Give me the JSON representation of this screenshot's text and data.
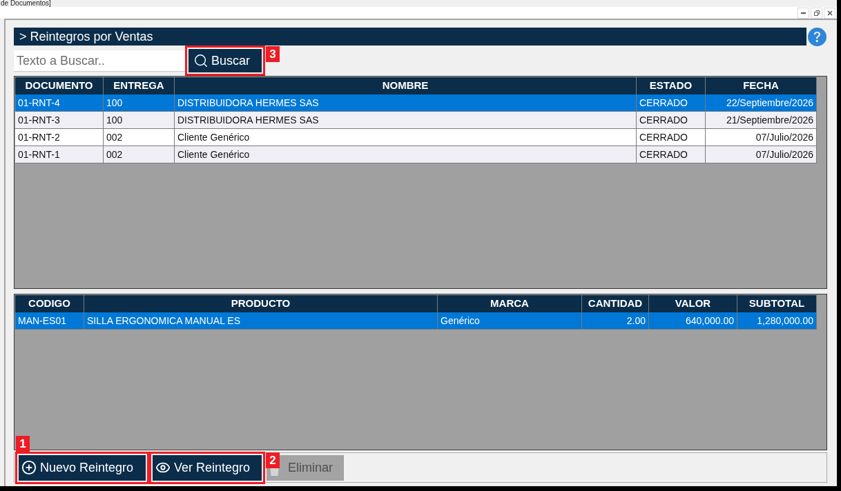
{
  "window": {
    "title": "de Documentos]"
  },
  "panel": {
    "title": "> Reintegros por Ventas"
  },
  "search": {
    "placeholder": "Texto a Buscar..",
    "button": {
      "label": "Buscar",
      "callout": "3"
    }
  },
  "documents_table": {
    "columns": [
      "DOCUMENTO",
      "ENTREGA",
      "NOMBRE",
      "ESTADO",
      "FECHA"
    ],
    "rows": [
      {
        "cells": [
          "01-RNT-4",
          "100",
          "DISTRIBUIDORA HERMES SAS",
          "CERRADO",
          "22/Septiembre/2026"
        ],
        "selected": true
      },
      {
        "cells": [
          "01-RNT-3",
          "100",
          "DISTRIBUIDORA HERMES SAS",
          "CERRADO",
          "21/Septiembre/2026"
        ],
        "selected": false
      },
      {
        "cells": [
          "01-RNT-2",
          "002",
          "Cliente Genérico",
          "CERRADO",
          "07/Julio/2026"
        ],
        "selected": false
      },
      {
        "cells": [
          "01-RNT-1",
          "002",
          "Cliente Genérico",
          "CERRADO",
          "07/Julio/2026"
        ],
        "selected": false
      }
    ]
  },
  "items_table": {
    "columns": [
      "CODIGO",
      "PRODUCTO",
      "MARCA",
      "CANTIDAD",
      "VALOR",
      "SUBTOTAL"
    ],
    "rows": [
      {
        "cells": [
          "MAN-ES01",
          "SILLA ERGONOMICA MANUAL ES",
          "Genérico",
          "2.00",
          "640,000.00",
          "1,280,000.00"
        ],
        "selected": true
      }
    ]
  },
  "actions": [
    {
      "kind": "add",
      "label": "Nuevo Reintegro",
      "disabled": false,
      "callout": "1"
    },
    {
      "kind": "view",
      "label": "Ver Reintegro",
      "disabled": false,
      "callout": "2"
    },
    {
      "kind": "delete",
      "label": "Eliminar",
      "disabled": true
    }
  ]
}
